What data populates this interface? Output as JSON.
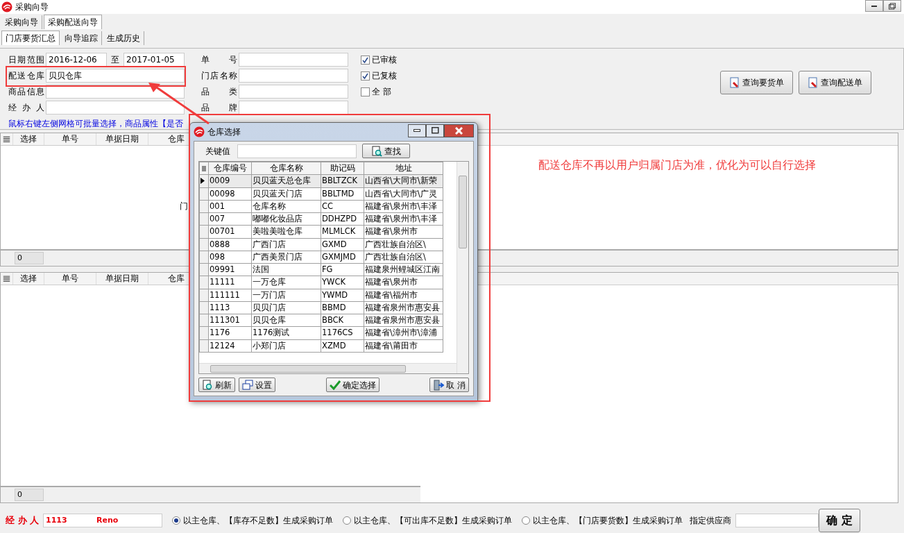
{
  "window": {
    "title": "采购向导"
  },
  "top_tabs": [
    {
      "label": "采购向导",
      "selected": false
    },
    {
      "label": "采购配送向导",
      "selected": true
    }
  ],
  "sub_tabs": [
    {
      "label": "门店要货汇总",
      "selected": true
    },
    {
      "label": "向导追踪",
      "selected": false
    },
    {
      "label": "生成历史",
      "selected": false
    }
  ],
  "filters": {
    "date_label": "日期范围",
    "date_from": "2016-12-06",
    "date_sep": "至",
    "date_to": "2017-01-05",
    "warehouse_label": "配送仓库",
    "warehouse": "贝贝仓库",
    "product_label": "商品信息",
    "handler_label": "经 办 人",
    "fields": [
      {
        "label": "单 号"
      },
      {
        "label": "门店名称"
      },
      {
        "label": "品 类"
      },
      {
        "label": "品 牌"
      }
    ]
  },
  "checks": [
    {
      "label": "已审核",
      "checked": true
    },
    {
      "label": "已复核",
      "checked": true
    },
    {
      "label": "全 部",
      "checked": false
    }
  ],
  "query_buttons": [
    "查询要货单",
    "查询配送单"
  ],
  "hint": "鼠标右键左侧网格可批量选择，商品属性【是否",
  "grids": [
    {
      "columns": [
        "选择",
        "单号",
        "单据日期",
        "仓库"
      ],
      "empty_text": "门",
      "count": "0"
    },
    {
      "columns": [
        "选择",
        "单号",
        "单据日期",
        "仓库"
      ],
      "count": "0"
    }
  ],
  "annotation": "配送仓库不再以用户归属门店为准，优化为可以自行选择",
  "dialog": {
    "title": "仓库选择",
    "keyword_label": "关键值",
    "search_button": "查找",
    "columns": [
      "仓库编号",
      "仓库名称",
      "助记码",
      "地址"
    ],
    "rows": [
      {
        "cells": [
          "0009",
          "贝贝蓝天总仓库",
          "BBLTZCK",
          "山西省\\大同市\\新荣"
        ],
        "selected": true
      },
      {
        "cells": [
          "00098",
          "贝贝蓝天门店",
          "BBLTMD",
          "山西省\\大同市\\广灵"
        ],
        "selected": false
      },
      {
        "cells": [
          "001",
          "仓库名称",
          "CC",
          "福建省\\泉州市\\丰泽"
        ],
        "selected": false
      },
      {
        "cells": [
          "007",
          "嘟嘟化妆品店",
          "DDHZPD",
          "福建省\\泉州市\\丰泽"
        ],
        "selected": false
      },
      {
        "cells": [
          "00701",
          "美啦美啦仓库",
          "MLMLCK",
          "福建省\\泉州市"
        ],
        "selected": false
      },
      {
        "cells": [
          "0888",
          "广西门店",
          "GXMD",
          "广西壮族自治区\\"
        ],
        "selected": false
      },
      {
        "cells": [
          "098",
          "广西美景门店",
          "GXMJMD",
          "广西壮族自治区\\"
        ],
        "selected": false
      },
      {
        "cells": [
          "09991",
          "法国",
          "FG",
          "福建泉州鲤城区江南"
        ],
        "selected": false
      },
      {
        "cells": [
          "11111",
          "一万仓库",
          "YWCK",
          "福建省\\泉州市"
        ],
        "selected": false
      },
      {
        "cells": [
          "111111",
          "一万门店",
          "YWMD",
          "福建省\\福州市"
        ],
        "selected": false
      },
      {
        "cells": [
          "1113",
          "贝贝门店",
          "BBMD",
          "福建省泉州市惠安县"
        ],
        "selected": false
      },
      {
        "cells": [
          "111301",
          "贝贝仓库",
          "BBCK",
          "福建省泉州市惠安县"
        ],
        "selected": false
      },
      {
        "cells": [
          "1176",
          "1176测试",
          "1176CS",
          "福建省\\漳州市\\漳浦"
        ],
        "selected": false
      },
      {
        "cells": [
          "12124",
          "小郑门店",
          "XZMD",
          "福建省\\莆田市"
        ],
        "selected": false
      }
    ],
    "buttons": [
      {
        "label": "刷新",
        "kind": "refresh"
      },
      {
        "label": "设置",
        "kind": "settings"
      },
      {
        "label": "确定选择",
        "kind": "confirm"
      },
      {
        "label": "取 消",
        "kind": "cancel"
      }
    ]
  },
  "bottom": {
    "handler_label": "经 办 人",
    "handler_code": "1113",
    "handler_name": "Reno",
    "options": [
      {
        "label": "以主仓库、【库存不足数】生成采购订单",
        "selected": true
      },
      {
        "label": "以主仓库、【可出库不足数】生成采购订单",
        "selected": false
      },
      {
        "label": "以主仓库、【门店要货数】生成采购订单",
        "selected": false
      }
    ],
    "supplier_label": "指定供应商",
    "confirm_button": "确 定"
  }
}
